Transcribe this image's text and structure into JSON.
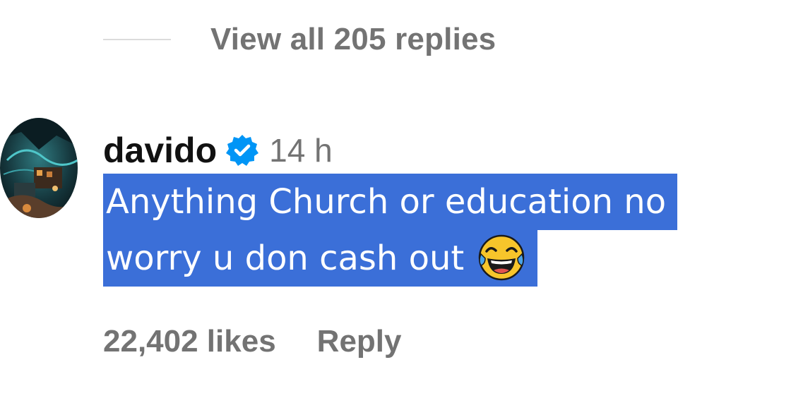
{
  "replies": {
    "view_all_label": "View all 205 replies"
  },
  "comment": {
    "username": "davido",
    "verified": true,
    "timestamp": "14 h",
    "text_line_1": "Anything Church or education no",
    "text_line_2": "worry u don cash out",
    "emoji": "face-with-tears-of-joy",
    "likes": "22,402 likes",
    "reply_label": "Reply"
  },
  "colors": {
    "selection_highlight": "#3b6fd8",
    "secondary_text": "#737373",
    "verified_badge": "#0095f6",
    "username_text": "#111111"
  },
  "icons": {
    "verified": "verified-badge-icon",
    "avatar": "avatar-image"
  }
}
